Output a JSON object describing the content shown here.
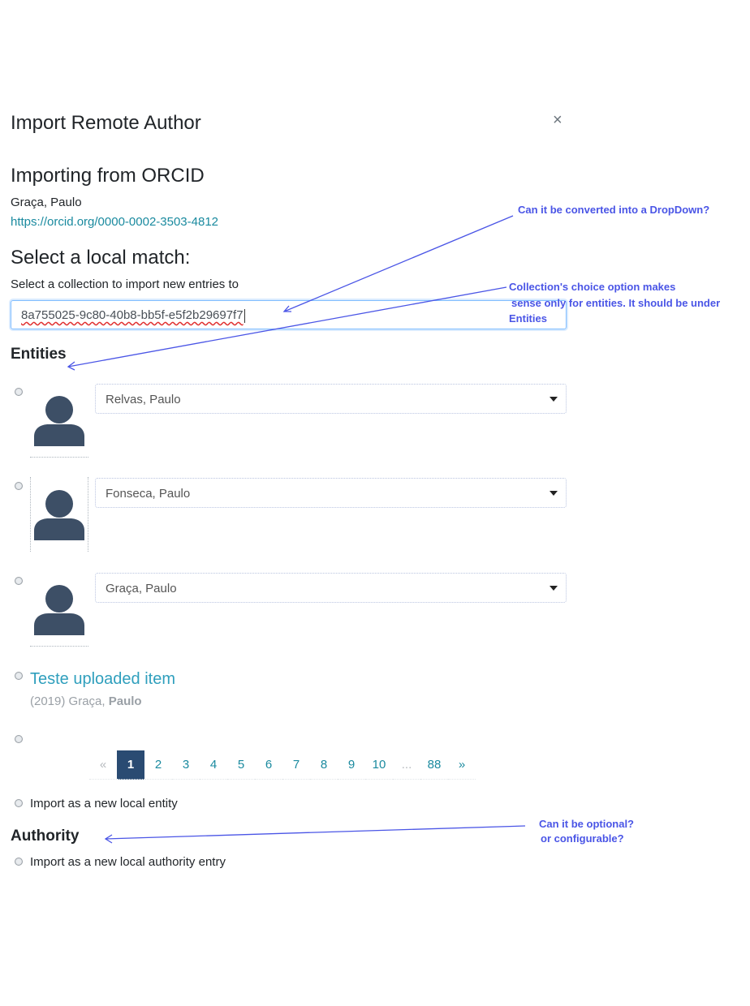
{
  "modal": {
    "title": "Import Remote Author",
    "close_symbol": "×",
    "source_heading": "Importing from ORCID",
    "author_name": "Graça, Paulo",
    "orcid_url": "https://orcid.org/0000-0002-3503-4812",
    "match_heading": "Select a local match:",
    "collection_label": "Select a collection to import new entries to",
    "collection_value": "8a755025-9c80-40b8-bb5f-e5f2b29697f7"
  },
  "entities": {
    "heading": "Entities",
    "candidates": [
      {
        "name": "Relvas, Paulo",
        "icon": "person-icon"
      },
      {
        "name": "Fonseca, Paulo",
        "icon": "person-icon"
      },
      {
        "name": "Graça, Paulo",
        "icon": "person-icon"
      }
    ],
    "item": {
      "title": "Teste uploaded item",
      "year": "(2019)",
      "author_prefix": "Graça,",
      "author_bold": "Paulo"
    },
    "pagination": {
      "prev": "«",
      "pages": [
        "1",
        "2",
        "3",
        "4",
        "5",
        "6",
        "7",
        "8",
        "9",
        "10",
        "...",
        "88"
      ],
      "active": "1",
      "next": "»"
    },
    "new_entity_label": "Import as a new local entity"
  },
  "authority": {
    "heading": "Authority",
    "new_entry_label": "Import as a new local authority entry"
  },
  "annotations": {
    "dropdown_question": "Can it be converted into a DropDown?",
    "collection_note_line1": "Collection's choice option makes",
    "collection_note_line2": "sense only for entities. It should be under",
    "collection_note_line3": "Entities",
    "optional_question_line1": "Can it be optional?",
    "optional_question_line2": "or configurable?",
    "color": "#4a55e6"
  }
}
